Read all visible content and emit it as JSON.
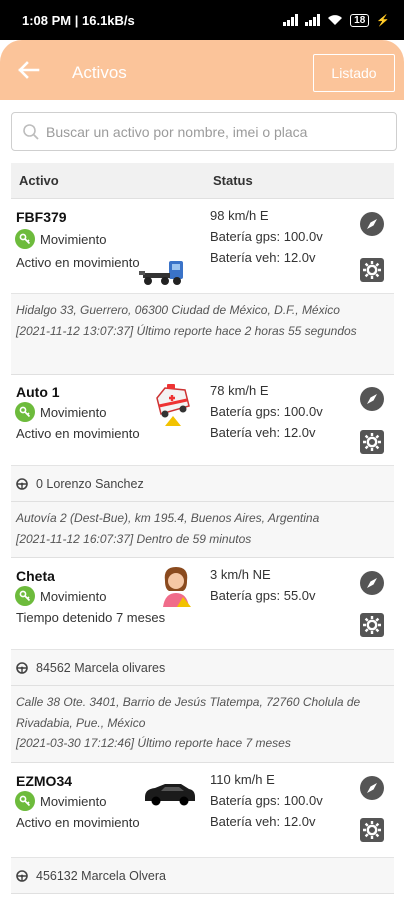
{
  "status_bar": {
    "time": "1:08 PM | 16.1kB/s",
    "battery": "18"
  },
  "header": {
    "title": "Activos",
    "listado_label": "Listado"
  },
  "search": {
    "placeholder": "Buscar un activo por nombre, imei o placa"
  },
  "columns": {
    "activo": "Activo",
    "status": "Status"
  },
  "assets": [
    {
      "name": "FBF379",
      "state": "Movimiento",
      "description": "Activo en movimiento",
      "speed": "98 km/h E",
      "gps_battery": "Batería gps: 100.0v",
      "veh_battery": "Batería veh: 12.0v",
      "icon": "truck-icon",
      "address": "Hidalgo 33, Guerrero, 06300 Ciudad de México, D.F., México",
      "report": "[2021-11-12 13:07:37] Último reporte hace 2 horas 55 segundos"
    },
    {
      "name": "Auto 1",
      "state": "Movimiento",
      "description": "Activo en movimiento",
      "speed": "78 km/h E",
      "gps_battery": "Batería gps: 100.0v",
      "veh_battery": "Batería veh: 12.0v",
      "icon": "ambulance-icon",
      "driver": "0 Lorenzo Sanchez",
      "address": "Autovía 2 (Dest-Bue), km 195.4, Buenos Aires, Argentina",
      "report": "[2021-11-12 16:07:37] Dentro de 59 minutos"
    },
    {
      "name": "Cheta",
      "state": "Movimiento",
      "description": "Tiempo detenido 7 meses",
      "speed": "3 km/h NE",
      "gps_battery": "Batería gps: 55.0v",
      "icon": "person-icon",
      "driver": "84562 Marcela olivares",
      "address": "Calle 38 Ote. 3401, Barrio de Jesús Tlatempa, 72760 Cholula de Rivadabia, Pue., México",
      "report": "[2021-03-30 17:12:46] Último reporte hace 7 meses"
    },
    {
      "name": "EZMO34",
      "state": "Movimiento",
      "description": "Activo en movimiento",
      "speed": "110 km/h E",
      "gps_battery": "Batería gps: 100.0v",
      "veh_battery": "Batería veh: 12.0v",
      "icon": "car-icon",
      "driver": "456132 Marcela Olvera"
    }
  ],
  "colors": {
    "header": "#fbc49a",
    "status_green": "#6dbb3c",
    "action_icon": "#555555"
  }
}
